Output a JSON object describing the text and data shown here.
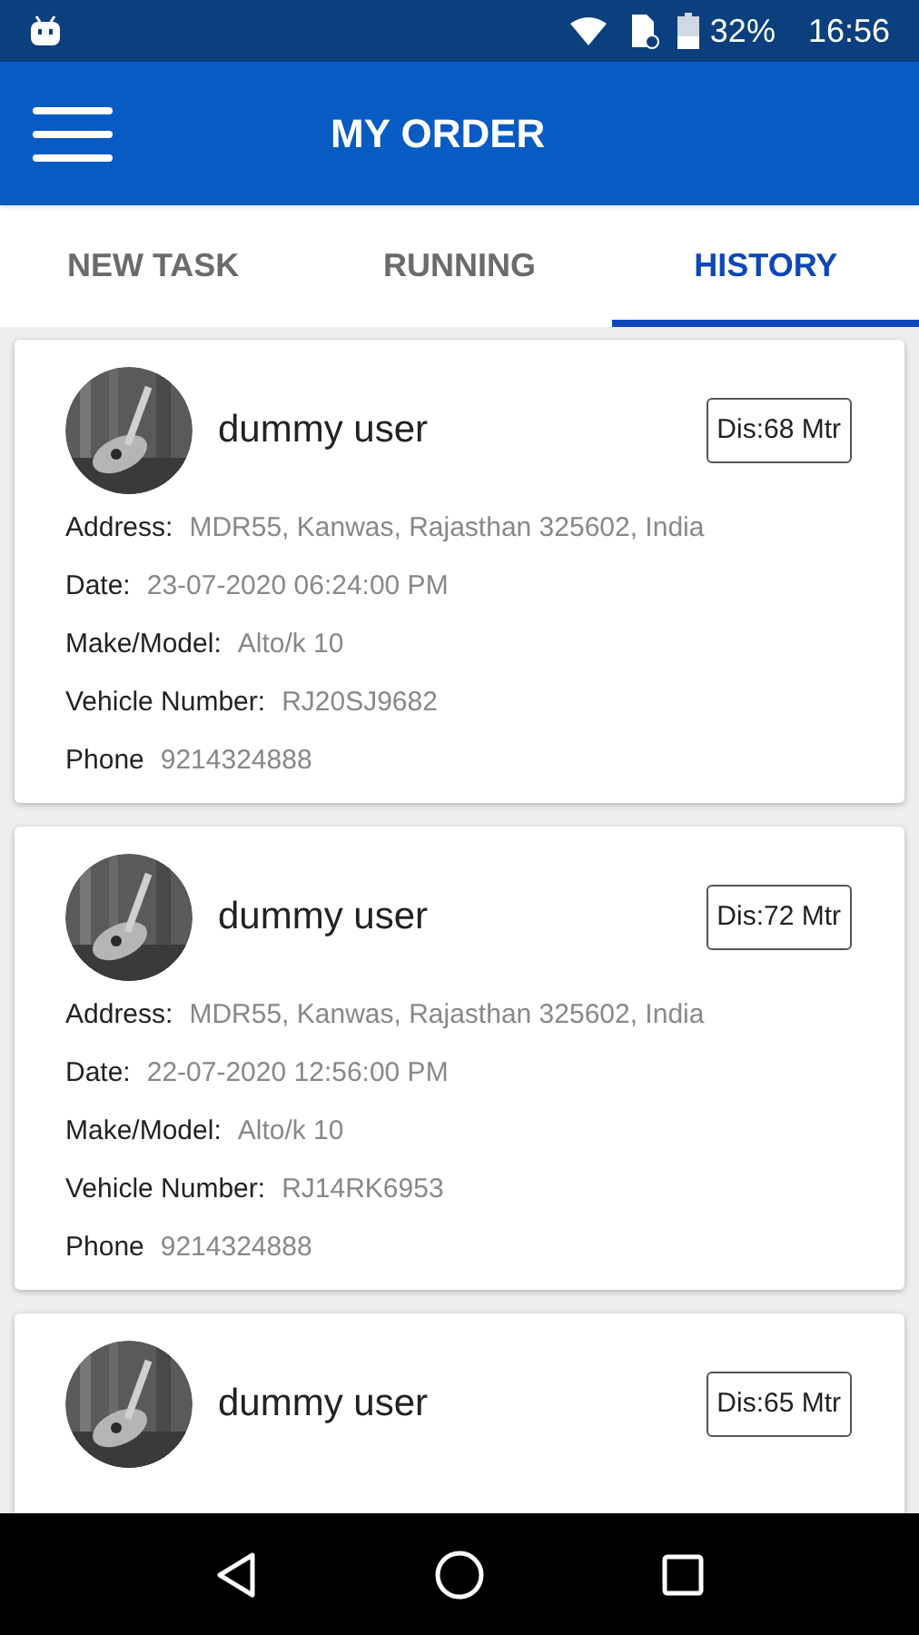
{
  "status_bar": {
    "battery": "32%",
    "time": "16:56"
  },
  "app_bar": {
    "title": "MY ORDER"
  },
  "tabs": [
    {
      "label": "NEW TASK",
      "selected": false
    },
    {
      "label": "RUNNING",
      "selected": false
    },
    {
      "label": "HISTORY",
      "selected": true
    }
  ],
  "orders": [
    {
      "name": "dummy user",
      "distance": "Dis:68 Mtr",
      "fields": [
        {
          "label": "Address:",
          "value": "MDR55, Kanwas, Rajasthan 325602, India"
        },
        {
          "label": "Date:",
          "value": "23-07-2020 06:24:00 PM"
        },
        {
          "label": "Make/Model:",
          "value": "Alto/k 10"
        },
        {
          "label": "Vehicle Number:",
          "value": "RJ20SJ9682"
        },
        {
          "label": "Phone",
          "value": "9214324888"
        }
      ]
    },
    {
      "name": "dummy user",
      "distance": "Dis:72 Mtr",
      "fields": [
        {
          "label": "Address:",
          "value": "MDR55, Kanwas, Rajasthan 325602, India"
        },
        {
          "label": "Date:",
          "value": "22-07-2020 12:56:00 PM"
        },
        {
          "label": "Make/Model:",
          "value": "Alto/k 10"
        },
        {
          "label": "Vehicle Number:",
          "value": "RJ14RK6953"
        },
        {
          "label": "Phone",
          "value": "9214324888"
        }
      ]
    },
    {
      "name": "dummy user",
      "distance": "Dis:65 Mtr"
    }
  ]
}
